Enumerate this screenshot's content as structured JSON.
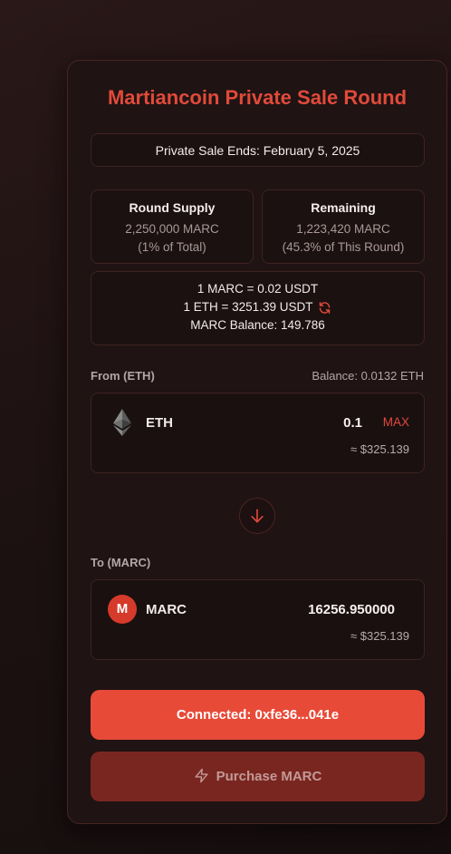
{
  "sale": {
    "title": "Martiancoin Private Sale Round",
    "ends": "Private Sale Ends: February 5, 2025"
  },
  "stats": {
    "round_supply_label": "Round Supply",
    "round_supply_value": "2,250,000 MARC",
    "round_supply_note": "(1% of Total)",
    "remaining_label": "Remaining",
    "remaining_value": "1,223,420 MARC",
    "remaining_note": "(45.3% of This Round)"
  },
  "rates": {
    "marc_rate": "1 MARC = 0.02 USDT",
    "eth_rate": "1 ETH = 3251.39 USDT",
    "marc_balance": "MARC Balance: 149.786"
  },
  "from": {
    "label": "From (ETH)",
    "balance": "Balance: 0.0132 ETH",
    "token": "ETH",
    "amount": "0.1",
    "max_label": "MAX",
    "usd": "≈ $325.139",
    "icon": "ethereum-icon"
  },
  "to": {
    "label": "To (MARC)",
    "token": "MARC",
    "badge": "M",
    "amount": "16256.950000",
    "usd": "≈ $325.139"
  },
  "buttons": {
    "connected": "Connected: 0xfe36...041e",
    "purchase": "Purchase MARC"
  },
  "colors": {
    "accent": "#e84a38",
    "title": "#e04a3a",
    "background": "#1f1313",
    "purchase_disabled": "#7a2620"
  }
}
